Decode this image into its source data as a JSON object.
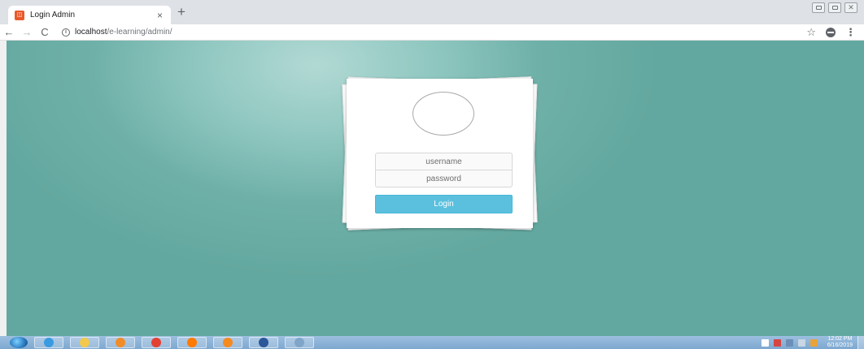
{
  "browser": {
    "tab_title": "Login Admin",
    "tab_close": "×",
    "new_tab": "+",
    "url_host": "localhost",
    "url_path": "/e-learning/admin/",
    "back": "←",
    "forward": "→",
    "reload": "C",
    "info": "i",
    "star": "☆",
    "menu": "⋮"
  },
  "login": {
    "username_placeholder": "username",
    "password_placeholder": "password",
    "submit_label": "Login"
  },
  "taskbar": {
    "clock_time": "12:02 PM",
    "clock_date": "6/16/2019",
    "apps": [
      {
        "name": "internet-explorer",
        "color": "#3a9be0"
      },
      {
        "name": "file-explorer",
        "color": "#f2c94c"
      },
      {
        "name": "media-player",
        "color": "#f28c28"
      },
      {
        "name": "chrome",
        "color": "#e34133"
      },
      {
        "name": "firefox",
        "color": "#ff7a00"
      },
      {
        "name": "sublime-text",
        "color": "#f58a1f"
      },
      {
        "name": "word",
        "color": "#2b579a"
      },
      {
        "name": "snipping-tool",
        "color": "#7fa6c9"
      }
    ]
  },
  "colors": {
    "background": "#63a8a0",
    "login_button": "#5bc0de",
    "taskbar": "#8fb4da"
  }
}
